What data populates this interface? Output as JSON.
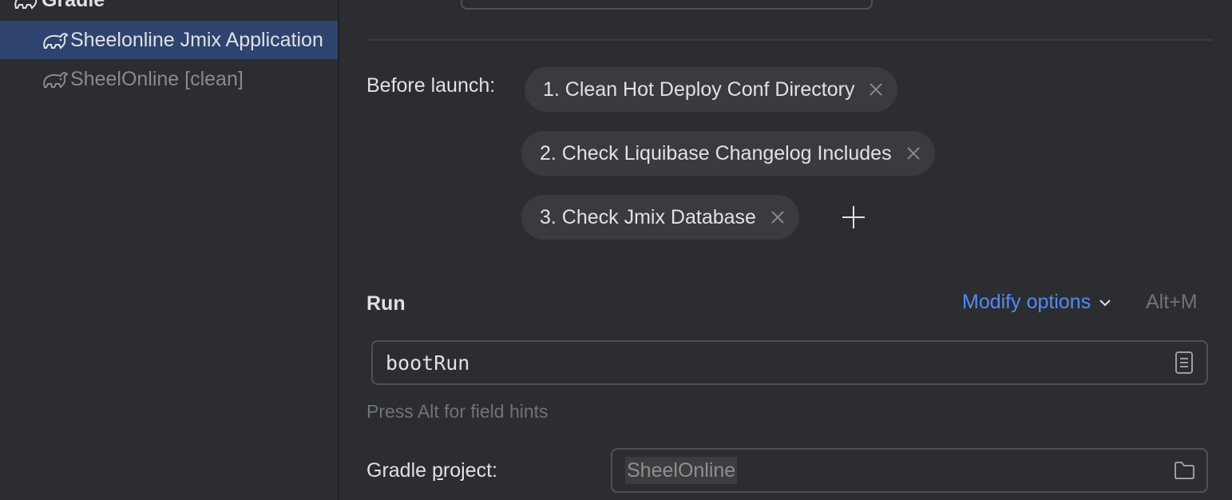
{
  "sidebar": {
    "group_label": "Gradle",
    "items": [
      {
        "label": "Sheelonline Jmix Application",
        "icon": "gradle-elephant-icon",
        "selected": true
      },
      {
        "label": "SheelOnline [clean]",
        "icon": "gradle-elephant-icon",
        "selected": false
      }
    ]
  },
  "before_launch": {
    "label": "Before launch:",
    "tasks": [
      {
        "label": "1. Clean Hot Deploy Conf Directory"
      },
      {
        "label": "2. Check Liquibase Changelog Includes"
      },
      {
        "label": "3. Check Jmix Database"
      }
    ],
    "add_icon": "plus-icon",
    "remove_icon": "close-icon"
  },
  "run": {
    "title": "Run",
    "modify_options_label": "Modify options",
    "modify_options_shortcut": "Alt+M",
    "task_value": "bootRun",
    "task_icon": "document-list-icon",
    "hint": "Press Alt for field hints",
    "gradle_project_label_pre": "Gradle ",
    "gradle_project_label_mnemonic": "p",
    "gradle_project_label_post": "roject:",
    "gradle_project_value": "SheelOnline",
    "gradle_project_icon": "folder-icon"
  },
  "colors": {
    "background": "#2b2d30",
    "selection": "#2e436e",
    "chip": "#393b40",
    "link": "#548af7",
    "muted": "#6f737a"
  }
}
